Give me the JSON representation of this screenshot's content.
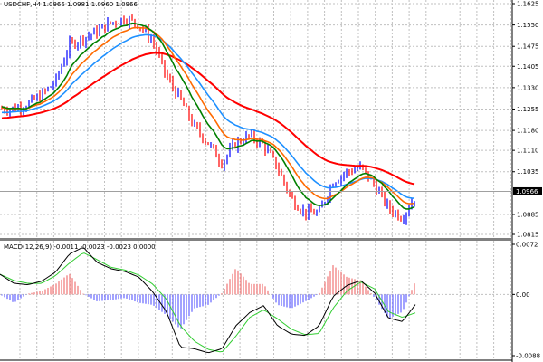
{
  "header": {
    "symbol": "USDCHF,H4",
    "ohlc": "1.0966 1.0981 1.0960 1.0966"
  },
  "indicator_header": {
    "name": "MACD(12,26,9)",
    "values": "-0.0011 -0.0023 -0.0023 0.0000"
  },
  "colors": {
    "bull_candle": "#0000ff",
    "bear_candle": "#ff0000",
    "ma_green": "#008000",
    "ma_orange": "#ff6a00",
    "ma_blue": "#1e90ff",
    "ma_red": "#ff0000",
    "macd_line": "#000000",
    "signal_line": "#32cd32",
    "hist_pos": "#f08080",
    "hist_neg": "#6f6fff",
    "grid": "#c0c0c0"
  },
  "chart_data": [
    {
      "type": "line",
      "title": "USDCHF,H4",
      "ylim": [
        1.0815,
        1.1625
      ],
      "y_ticks": [
        "1.1625",
        "1.1550",
        "1.1475",
        "1.1405",
        "1.1330",
        "1.1255",
        "1.1180",
        "1.1110",
        "1.1035",
        "1.0885",
        "1.0815"
      ],
      "current_price": "1.0966",
      "close": [
        1.1257,
        1.1257,
        1.1272,
        1.1304,
        1.1352,
        1.1479,
        1.1504,
        1.1527,
        1.1558,
        1.1574,
        1.1552,
        1.1495,
        1.1368,
        1.1288,
        1.1193,
        1.1136,
        1.1066,
        1.1136,
        1.1161,
        1.1129,
        1.105,
        1.0939,
        1.0891,
        1.0891,
        1.1002,
        1.1034,
        1.105,
        1.0987,
        1.0907,
        1.0875,
        1.0955
      ],
      "grid": true
    },
    {
      "type": "bar",
      "title": "MACD(12,26,9)",
      "ylim": [
        -0.0088,
        0.0072
      ],
      "y_ticks": [
        "0.0072",
        "0.00",
        "-0.0088"
      ],
      "series": [
        {
          "role": "macd",
          "values": [
            0.0029,
            0.0016,
            0.0014,
            0.0019,
            0.0032,
            0.0058,
            0.0068,
            0.0046,
            0.0037,
            0.0033,
            0.0025,
            0.0004,
            -0.0025,
            -0.0076,
            -0.0078,
            -0.0084,
            -0.0078,
            -0.0045,
            -0.0026,
            -0.0016,
            -0.0045,
            -0.0057,
            -0.0059,
            -0.0045,
            -0.0003,
            0.0013,
            0.002,
            0.0002,
            -0.0034,
            -0.0039,
            -0.0013
          ]
        },
        {
          "role": "signal",
          "values": [
            0.0029,
            0.002,
            0.0016,
            0.0016,
            0.0027,
            0.0045,
            0.006,
            0.005,
            0.0039,
            0.0035,
            0.0028,
            0.0015,
            -0.0007,
            -0.0045,
            -0.0067,
            -0.0079,
            -0.0083,
            -0.006,
            -0.0033,
            -0.0022,
            -0.0035,
            -0.005,
            -0.0058,
            -0.0056,
            -0.002,
            0.0005,
            0.0018,
            0.0008,
            -0.0025,
            -0.0033,
            -0.0026
          ]
        },
        {
          "role": "histogram",
          "values": [
            0,
            -0.0012,
            0.0001,
            0.0005,
            0.0015,
            0.003,
            0.0001,
            -0.001,
            -0.0008,
            -0.0005,
            -0.0012,
            -0.0015,
            -0.003,
            -0.005,
            -0.002,
            -0.0015,
            0.0002,
            0.0038,
            0.0015,
            0.0015,
            -0.0015,
            -0.002,
            -0.001,
            0.0001,
            0.0042,
            0.0025,
            0.002,
            -0.0005,
            -0.0035,
            -0.0025,
            0.0022
          ]
        }
      ],
      "grid": true
    }
  ]
}
